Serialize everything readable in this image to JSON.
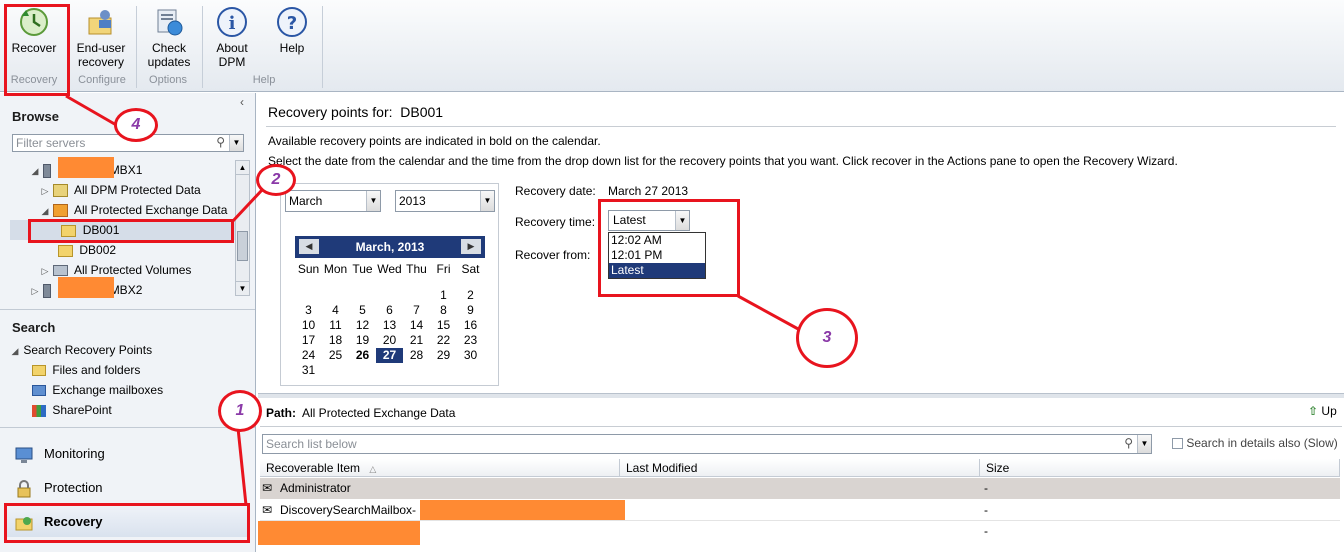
{
  "ribbon": {
    "buttons": [
      {
        "label": "Recover",
        "icon": "recover-icon"
      },
      {
        "label": "End-user\nrecovery",
        "icon": "end-user-recovery-icon"
      },
      {
        "label": "Check\nupdates",
        "icon": "check-updates-icon"
      },
      {
        "label": "About\nDPM",
        "icon": "info-icon"
      },
      {
        "label": "Help",
        "icon": "help-icon"
      }
    ],
    "groups": [
      "Recovery",
      "Configure",
      "Options",
      "Help"
    ]
  },
  "browse": {
    "title": "Browse",
    "filter_placeholder": "Filter servers",
    "tree": [
      {
        "label": "MBX1"
      },
      {
        "label": "All DPM Protected Data"
      },
      {
        "label": "All Protected Exchange Data"
      },
      {
        "label": "DB001"
      },
      {
        "label": "DB002"
      },
      {
        "label": "All Protected Volumes"
      },
      {
        "label": "MBX2"
      }
    ]
  },
  "search": {
    "title": "Search",
    "root": "Search Recovery Points",
    "items": [
      "Files and folders",
      "Exchange mailboxes",
      "SharePoint"
    ]
  },
  "nav": {
    "items": [
      "Monitoring",
      "Protection",
      "Recovery"
    ]
  },
  "recovery_points": {
    "title": "Recovery points for:",
    "db": "DB001",
    "line1": "Available recovery points are indicated in bold on the calendar.",
    "line2": "Select the date from the calendar and the time from the drop down list for the recovery points that you want. Click recover in the Actions pane to open the Recovery Wizard.",
    "month_select": "March",
    "year_select": "2013",
    "calendar": {
      "title": "March, 2013",
      "daynames": [
        "Sun",
        "Mon",
        "Tue",
        "Wed",
        "Thu",
        "Fri",
        "Sat"
      ],
      "weeks": [
        [
          "",
          "",
          "",
          "",
          "",
          "1",
          "2"
        ],
        [
          "3",
          "4",
          "5",
          "6",
          "7",
          "8",
          "9"
        ],
        [
          "10",
          "11",
          "12",
          "13",
          "14",
          "15",
          "16"
        ],
        [
          "17",
          "18",
          "19",
          "20",
          "21",
          "22",
          "23"
        ],
        [
          "24",
          "25",
          "26",
          "27",
          "28",
          "29",
          "30"
        ],
        [
          "31",
          "",
          "",
          "",
          "",
          "",
          ""
        ]
      ],
      "bold_days": [
        "26"
      ],
      "selected_day": "27"
    },
    "date_label": "Recovery date:",
    "date_value": "March 27 2013",
    "time_label": "Recovery time:",
    "time_value": "Latest",
    "time_options": [
      "12:02 AM",
      "12:01 PM",
      "Latest"
    ],
    "from_label": "Recover from:"
  },
  "lower": {
    "path_label": "Path:",
    "path_value": "All Protected Exchange Data",
    "up_label": "Up",
    "search_placeholder": "Search list below",
    "search_details_label": "Search in details also (Slow)",
    "columns": [
      "Recoverable Item",
      "Last Modified",
      "Size"
    ],
    "rows": [
      {
        "name": "Administrator",
        "modified": "",
        "size": "-"
      },
      {
        "name": "DiscoverySearchMailbox-",
        "modified": "",
        "size": "-"
      },
      {
        "name": "",
        "modified": "",
        "size": "-"
      }
    ]
  },
  "annotations": [
    "1",
    "2",
    "3",
    "4"
  ],
  "colors": {
    "annotation": "#e8141e",
    "calendar_header": "#1f3a79",
    "redaction": "#ff8a33",
    "number": "#8b3aa8"
  }
}
